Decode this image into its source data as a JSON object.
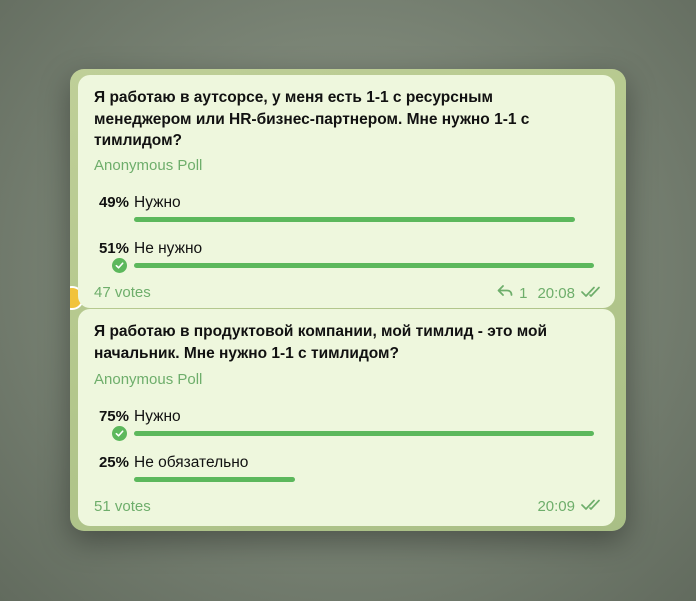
{
  "polls": [
    {
      "question": "Я работаю в аутсорсе, у меня есть 1-1 с ресурсным менеджером или HR-бизнес-партнером. Мне нужно 1-1 с тимлидом?",
      "type": "Anonymous Poll",
      "options": [
        {
          "percent_label": "49%",
          "label": "Нужно",
          "share": 0.49,
          "chosen": false
        },
        {
          "percent_label": "51%",
          "label": "Не нужно",
          "share": 0.51,
          "chosen": true
        }
      ],
      "votes": "47 votes",
      "replies": "1",
      "time": "20:08"
    },
    {
      "question": "Я работаю в продуктовой компании, мой тимлид - это мой начальник. Мне нужно 1-1 с тимлидом?",
      "type": "Anonymous Poll",
      "options": [
        {
          "percent_label": "75%",
          "label": "Нужно",
          "share": 0.75,
          "chosen": true
        },
        {
          "percent_label": "25%",
          "label": "Не обязательно",
          "share": 0.25,
          "chosen": false
        }
      ],
      "votes": "51 votes",
      "time": "20:09"
    }
  ],
  "colors": {
    "accent": "#5cb85c",
    "secondary_text": "#6eae6b",
    "bubble": "#eef7dd"
  }
}
